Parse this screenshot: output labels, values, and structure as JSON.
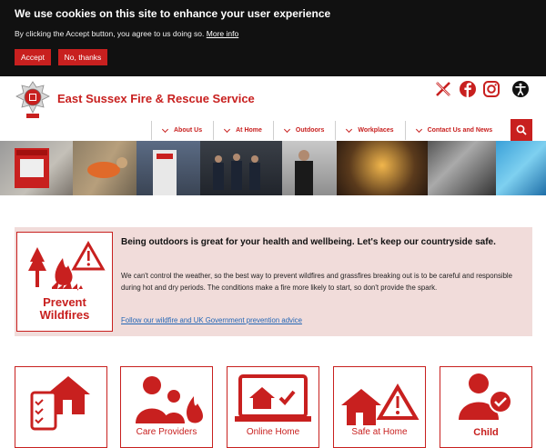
{
  "cookie": {
    "title": "We use cookies on this site to enhance your user experience",
    "message": "By clicking the Accept button, you agree to us doing so.",
    "more_info": "More info",
    "accept_label": "Accept",
    "decline_label": "No, thanks"
  },
  "header": {
    "site_name": "East Sussex Fire & Rescue Service",
    "social_icons": [
      "x-icon",
      "facebook-icon",
      "instagram-icon",
      "accessibility-icon"
    ]
  },
  "nav": {
    "items": [
      {
        "label": "About Us"
      },
      {
        "label": "At Home"
      },
      {
        "label": "Outdoors"
      },
      {
        "label": "Workplaces"
      },
      {
        "label": "Contact Us and News"
      }
    ]
  },
  "alert": {
    "logo_text_1": "Prevent",
    "logo_text_2": "Wildfires",
    "heading": "Being outdoors is great for your health and wellbeing. Let's keep our countryside safe.",
    "body": "We can't control the weather, so the best way to prevent wildfires and grassfires breaking out is to be careful and responsible during hot and dry periods. The conditions make a fire more likely to start, so don't provide the spark.",
    "link": "Follow our wildfire and UK Government prevention advice"
  },
  "cards": [
    {
      "label": ""
    },
    {
      "label": "Care Providers"
    },
    {
      "label": "Online Home"
    },
    {
      "label": "Safe at Home"
    },
    {
      "label": "Child"
    }
  ],
  "colors": {
    "brand_red": "#c8201f",
    "banner_dark": "#111111",
    "alert_bg": "#f1dcda"
  }
}
